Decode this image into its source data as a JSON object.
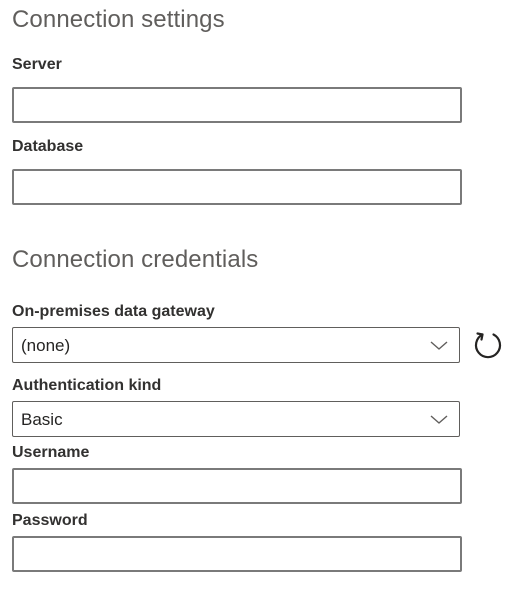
{
  "connection_settings": {
    "title": "Connection settings",
    "server": {
      "label": "Server",
      "value": ""
    },
    "database": {
      "label": "Database",
      "value": ""
    }
  },
  "connection_credentials": {
    "title": "Connection credentials",
    "gateway": {
      "label": "On-premises data gateway",
      "selected": "(none)"
    },
    "auth_kind": {
      "label": "Authentication kind",
      "selected": "Basic"
    },
    "username": {
      "label": "Username",
      "value": ""
    },
    "password": {
      "label": "Password",
      "value": ""
    }
  },
  "icons": {
    "refresh": "refresh-icon",
    "chevron": "chevron-down-icon"
  },
  "colors": {
    "border": "#7a7a7a",
    "title": "#605e5c",
    "label": "#323130"
  }
}
